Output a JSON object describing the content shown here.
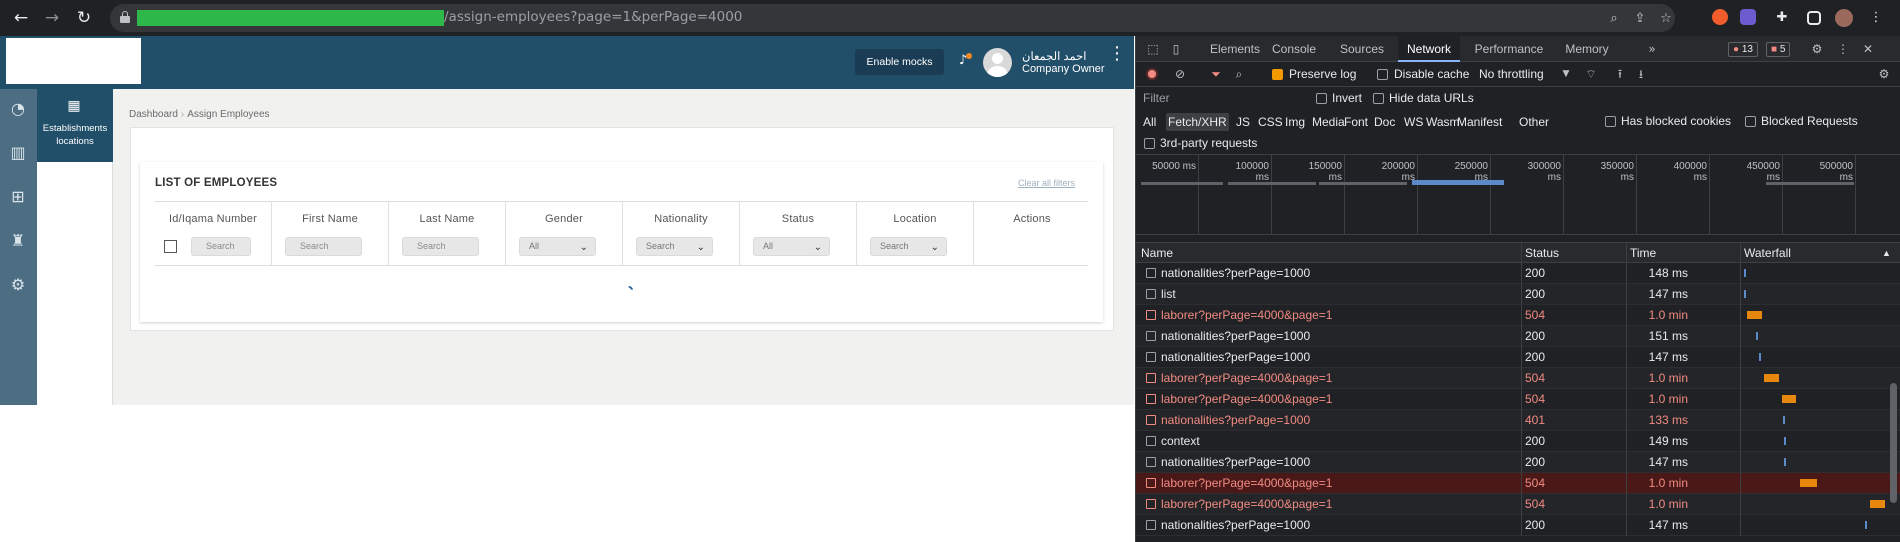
{
  "browser": {
    "url_path": "/assign-employees?page=1&perPage=4000"
  },
  "app": {
    "enable_mocks": "Enable mocks",
    "user_name": "احمد الجمعان",
    "user_role": "Company Owner",
    "subnav_label": "Establishments locations",
    "breadcrumb": [
      "Dashboard",
      "Assign Employees"
    ],
    "card_title": "LIST OF EMPLOYEES",
    "clear_filters": "Clear all filters",
    "columns": [
      {
        "label": "Id/Iqama Number",
        "filter": "Search",
        "kind": "input"
      },
      {
        "label": "First Name",
        "filter": "Search",
        "kind": "input"
      },
      {
        "label": "Last Name",
        "filter": "Search",
        "kind": "input"
      },
      {
        "label": "Gender",
        "filter": "All",
        "kind": "select"
      },
      {
        "label": "Nationality",
        "filter": "Search",
        "kind": "select"
      },
      {
        "label": "Status",
        "filter": "All",
        "kind": "select"
      },
      {
        "label": "Location",
        "filter": "Search",
        "kind": "select"
      },
      {
        "label": "Actions",
        "filter": "",
        "kind": "none"
      }
    ]
  },
  "devtools": {
    "tabs": [
      "Elements",
      "Console",
      "Sources",
      "Network",
      "Performance",
      "Memory"
    ],
    "active_tab": "Network",
    "errors": "13",
    "warnings": "5",
    "toolbar": {
      "preserve_log": "Preserve log",
      "disable_cache": "Disable cache",
      "throttling": "No throttling"
    },
    "filter": {
      "placeholder": "Filter",
      "invert": "Invert",
      "hide_data_urls": "Hide data URLs",
      "types": [
        "All",
        "Fetch/XHR",
        "JS",
        "CSS",
        "Img",
        "Media",
        "Font",
        "Doc",
        "WS",
        "Wasm",
        "Manifest",
        "Other"
      ],
      "active_type": "Fetch/XHR",
      "has_blocked_cookies": "Has blocked cookies",
      "blocked_requests": "Blocked Requests",
      "third_party": "3rd-party requests"
    },
    "overview_ticks": [
      "50000 ms",
      "100000 ms",
      "150000 ms",
      "200000 ms",
      "250000 ms",
      "300000 ms",
      "350000 ms",
      "400000 ms",
      "450000 ms",
      "500000 ms",
      "5"
    ],
    "columns": {
      "name": "Name",
      "status": "Status",
      "time": "Time",
      "waterfall": "Waterfall"
    },
    "requests": [
      {
        "name": "nationalities?perPage=1000",
        "status": "200",
        "time": "148 ms",
        "error": false,
        "wf_start": 0.01,
        "wf_len": 0.01,
        "wf_color": "#5b8ac9"
      },
      {
        "name": "list",
        "status": "200",
        "time": "147 ms",
        "error": false,
        "wf_start": 0.01,
        "wf_len": 0.01,
        "wf_color": "#5b8ac9"
      },
      {
        "name": "laborer?perPage=4000&page=1",
        "status": "504",
        "time": "1.0 min",
        "error": true,
        "wf_start": 0.03,
        "wf_len": 0.1,
        "wf_color": "#e8870e"
      },
      {
        "name": "nationalities?perPage=1000",
        "status": "200",
        "time": "151 ms",
        "error": false,
        "wf_start": 0.09,
        "wf_len": 0.01,
        "wf_color": "#5b8ac9"
      },
      {
        "name": "nationalities?perPage=1000",
        "status": "200",
        "time": "147 ms",
        "error": false,
        "wf_start": 0.11,
        "wf_len": 0.01,
        "wf_color": "#5b8ac9"
      },
      {
        "name": "laborer?perPage=4000&page=1",
        "status": "504",
        "time": "1.0 min",
        "error": true,
        "wf_start": 0.15,
        "wf_len": 0.1,
        "wf_color": "#e8870e"
      },
      {
        "name": "laborer?perPage=4000&page=1",
        "status": "504",
        "time": "1.0 min",
        "error": true,
        "wf_start": 0.27,
        "wf_len": 0.1,
        "wf_color": "#e8870e"
      },
      {
        "name": "nationalities?perPage=1000",
        "status": "401",
        "time": "133 ms",
        "error": true,
        "wf_start": 0.28,
        "wf_len": 0.01,
        "wf_color": "#5b8ac9"
      },
      {
        "name": "context",
        "status": "200",
        "time": "149 ms",
        "error": false,
        "wf_start": 0.29,
        "wf_len": 0.01,
        "wf_color": "#5b8ac9"
      },
      {
        "name": "nationalities?perPage=1000",
        "status": "200",
        "time": "147 ms",
        "error": false,
        "wf_start": 0.29,
        "wf_len": 0.01,
        "wf_color": "#5b8ac9"
      },
      {
        "name": "laborer?perPage=4000&page=1",
        "status": "504",
        "time": "1.0 min",
        "error": true,
        "wf_start": 0.4,
        "wf_len": 0.12,
        "wf_color": "#e8870e"
      },
      {
        "name": "laborer?perPage=4000&page=1",
        "status": "504",
        "time": "1.0 min",
        "error": true,
        "wf_start": 0.89,
        "wf_len": 0.1,
        "wf_color": "#e8870e"
      },
      {
        "name": "nationalities?perPage=1000",
        "status": "200",
        "time": "147 ms",
        "error": false,
        "wf_start": 0.85,
        "wf_len": 0.01,
        "wf_color": "#5b8ac9"
      }
    ],
    "selected_row": 10
  }
}
